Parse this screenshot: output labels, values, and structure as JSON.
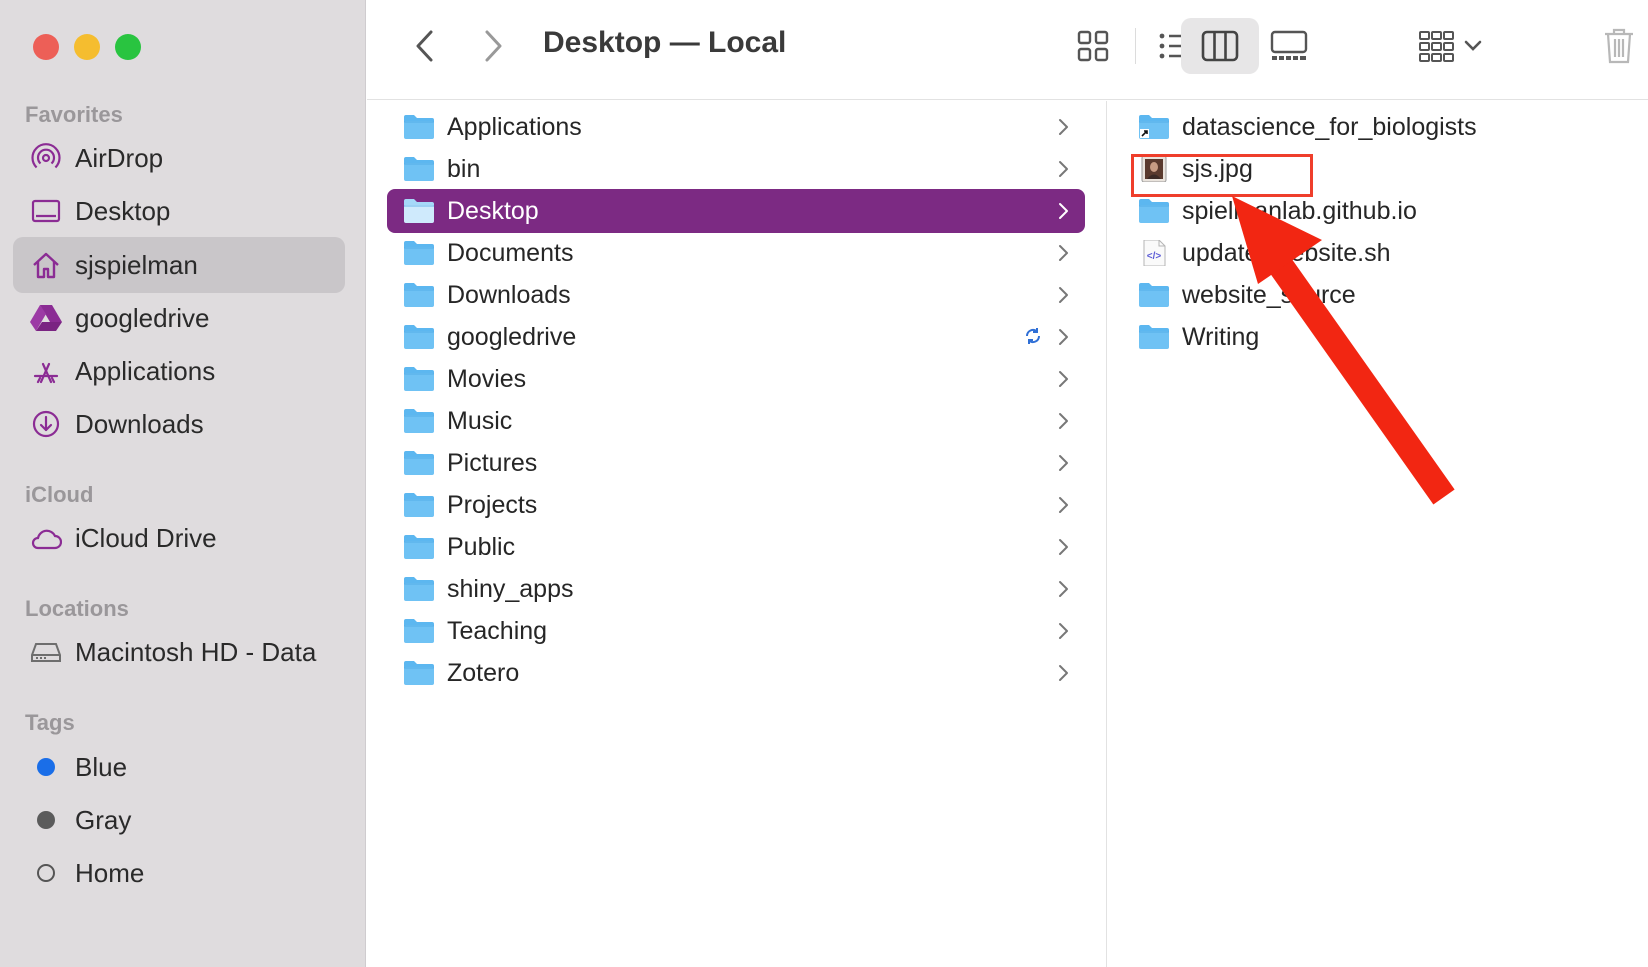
{
  "window": {
    "title": "Desktop — Local"
  },
  "sidebar": {
    "favorites_label": "Favorites",
    "favorites": [
      {
        "label": "AirDrop",
        "icon": "airdrop-icon"
      },
      {
        "label": "Desktop",
        "icon": "desktop-icon"
      },
      {
        "label": "sjspielman",
        "icon": "home-icon",
        "selected": true
      },
      {
        "label": "googledrive",
        "icon": "google-drive-icon"
      },
      {
        "label": "Applications",
        "icon": "applications-icon"
      },
      {
        "label": "Downloads",
        "icon": "downloads-icon"
      }
    ],
    "icloud_label": "iCloud",
    "icloud": [
      {
        "label": "iCloud Drive",
        "icon": "cloud-icon"
      }
    ],
    "locations_label": "Locations",
    "locations": [
      {
        "label": "Macintosh HD - Data",
        "icon": "disk-icon"
      }
    ],
    "tags_label": "Tags",
    "tags": [
      {
        "label": "Blue",
        "color": "#1a6ee8"
      },
      {
        "label": "Gray",
        "color": "#5b5b5b"
      },
      {
        "label": "Home",
        "color": "none"
      }
    ]
  },
  "colors": {
    "accent": "#7c2a83",
    "folder": "#5cb7f0",
    "highlight_box": "#ef3e2b",
    "arrow": "#f22612"
  },
  "column1": [
    {
      "name": "Applications",
      "icon": "applications-folder-icon"
    },
    {
      "name": "bin",
      "icon": "folder-icon"
    },
    {
      "name": "Desktop",
      "icon": "desktop-folder-icon",
      "selected": true
    },
    {
      "name": "Documents",
      "icon": "documents-folder-icon"
    },
    {
      "name": "Downloads",
      "icon": "downloads-folder-icon"
    },
    {
      "name": "googledrive",
      "icon": "googledrive-folder-icon",
      "syncing": true
    },
    {
      "name": "Movies",
      "icon": "movies-folder-icon"
    },
    {
      "name": "Music",
      "icon": "music-folder-icon"
    },
    {
      "name": "Pictures",
      "icon": "pictures-folder-icon"
    },
    {
      "name": "Projects",
      "icon": "folder-icon"
    },
    {
      "name": "Public",
      "icon": "public-folder-icon"
    },
    {
      "name": "shiny_apps",
      "icon": "folder-icon"
    },
    {
      "name": "Teaching",
      "icon": "folder-icon"
    },
    {
      "name": "Zotero",
      "icon": "folder-icon"
    }
  ],
  "column2": [
    {
      "name": "datascience_for_biologists",
      "icon": "alias-folder-icon"
    },
    {
      "name": "sjs.jpg",
      "icon": "image-file-icon",
      "highlighted": true
    },
    {
      "name": "spielmanlab.github.io",
      "icon": "folder-icon"
    },
    {
      "name": "update_website.sh",
      "icon": "script-file-icon"
    },
    {
      "name": "website_source",
      "icon": "folder-icon"
    },
    {
      "name": "Writing",
      "icon": "folder-icon"
    }
  ]
}
